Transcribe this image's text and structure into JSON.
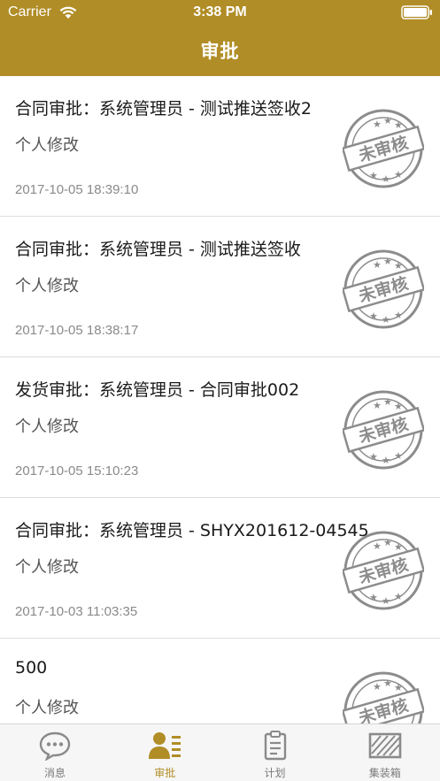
{
  "status_bar": {
    "carrier": "Carrier",
    "time": "3:38 PM",
    "wifi_icon": "wifi-icon",
    "battery_icon": "battery-icon"
  },
  "nav": {
    "title": "审批"
  },
  "colors": {
    "brand": "#b08d26",
    "stamp": "#8c8c8c",
    "tab_inactive": "#7a7a7a"
  },
  "approvals": [
    {
      "title": "合同审批：系统管理员 - 测试推送签收2",
      "subtitle": "个人修改",
      "date": "2017-10-05 18:39:10",
      "stamp": "未审核"
    },
    {
      "title": "合同审批：系统管理员 - 测试推送签收",
      "subtitle": "个人修改",
      "date": "2017-10-05 18:38:17",
      "stamp": "未审核"
    },
    {
      "title": "发货审批：系统管理员 - 合同审批002",
      "subtitle": "个人修改",
      "date": "2017-10-05 15:10:23",
      "stamp": "未审核"
    },
    {
      "title": "合同审批：系统管理员 - SHYX201612-04545",
      "subtitle": "个人修改",
      "date": "2017-10-03 11:03:35",
      "stamp": "未审核"
    },
    {
      "title": "500",
      "subtitle": "个人修改",
      "date": "",
      "stamp": "未审核"
    }
  ],
  "tabs": [
    {
      "label": "消息",
      "icon": "chat-bubble-icon",
      "active": false
    },
    {
      "label": "审批",
      "icon": "approval-user-icon",
      "active": true
    },
    {
      "label": "计划",
      "icon": "clipboard-icon",
      "active": false
    },
    {
      "label": "集装箱",
      "icon": "container-icon",
      "active": false
    }
  ]
}
